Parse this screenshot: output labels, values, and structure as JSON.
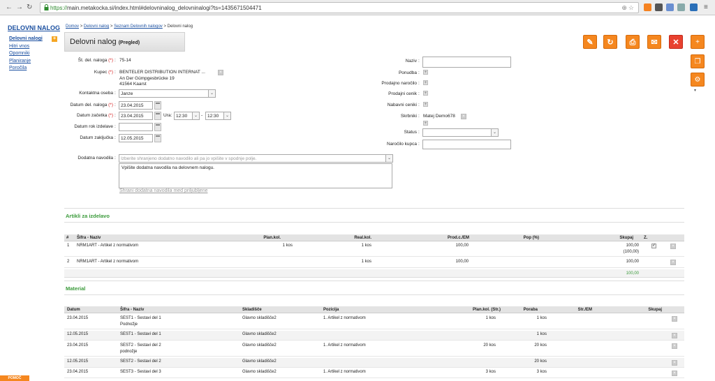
{
  "browser": {
    "url_scheme": "https://",
    "url_rest": "main.metakocka.si/index.html#delovninalog_delovninalogi?ts=1435671504471"
  },
  "sidebar": {
    "title": "DELOVNI NALOG",
    "items": [
      {
        "label": "Delovni nalogi"
      },
      {
        "label": "Hitri vnos"
      },
      {
        "label": "Opomniki"
      },
      {
        "label": "Planiranje"
      },
      {
        "label": "Poročila"
      }
    ],
    "help_label": "POMOČ"
  },
  "breadcrumb": {
    "home": "Domov",
    "sep": ">",
    "l1": "Delovni nalog",
    "l2": "Seznam Delovnih nalogov",
    "current": "Delovni nalog"
  },
  "page": {
    "title": "Delovni nalog",
    "mode": "(Pregled)"
  },
  "toolbar": {
    "edit_icon": "✎",
    "refresh_icon": "↻",
    "print_icon": "⎙",
    "mail_icon": "✉",
    "delete_icon": "✕",
    "add_icon": "+",
    "copy_icon": "❐",
    "settings_icon": "⚙",
    "more_icon": "▾"
  },
  "form_left": {
    "st_label": "Št. del. naloga",
    "st_value": "75-14",
    "kupec_label": "Kupec",
    "kupec_line1": "BENTELER DISTRIBUTION INTERNAT ...",
    "kupec_line2": "An Der Gümpgesbrücke 19",
    "kupec_line3": "41564 Kaarst",
    "kontakt_label": "Kontaktna oseba",
    "kontakt_value": "Janze",
    "datum_del_label": "Datum del. naloga",
    "datum_del_value": "23.04.2015",
    "datum_zac_label": "Datum začetka",
    "datum_zac_value": "23.04.2015",
    "ura_label": "Ura:",
    "ura_from": "12:30",
    "ura_to": "12:30",
    "ura_dash": "-",
    "rok_label": "Datum rok izdelave",
    "rok_value": "",
    "zakljucka_label": "Datum zaključka",
    "zakljucka_value": "12.05.2015",
    "req_mark": "(*)",
    "colon": ":"
  },
  "form_right": {
    "naziv_label": "Naziv",
    "ponudba_label": "Ponudba",
    "prodajno_narocilo_label": "Prodajno naročilo",
    "prodajni_cenik_label": "Prodajni cenik",
    "nabavni_ceniki_label": "Nabavni ceniki",
    "skrbniki_label": "Skrbniki",
    "skrbniki_value": "Matej Demo678",
    "status_label": "Status",
    "narocilo_kupca_label": "Naročilo kupca"
  },
  "dodatna": {
    "label": "Dodatna navodila",
    "select_placeholder": "Izberite shranjeno dodatno navodilo ali pa jo vpišite v spodnje polje.",
    "text": "Vpišite dodatna navodila na delovnem nalogu.",
    "save_link": "Shrani dodatna navodila med priljubljene"
  },
  "artikli": {
    "title": "Artikli za izdelavo",
    "headers": [
      "#",
      "Šifra - Naziv",
      "Plan.kol.",
      "Real.kol.",
      "Prod.c./EM",
      "Pop (%)",
      "Skupaj",
      "Z."
    ],
    "rows": [
      {
        "n": "1",
        "name": "NRM1ART - Artikel z normativom",
        "plan": "1 kos",
        "real": "1 kos",
        "prod": "100,00",
        "pop": "",
        "skupaj": "100,00",
        "skupaj2": "(100,00)",
        "z": "✓"
      },
      {
        "n": "2",
        "name": "NRM1ART - Artikel z normativom",
        "plan": "",
        "real": "1 kos",
        "prod": "100,00",
        "pop": "",
        "skupaj": "100,00",
        "skupaj2": "",
        "z": ""
      }
    ],
    "total": "100,00"
  },
  "material": {
    "title": "Material",
    "headers": [
      "Datum",
      "Šifra - Naziv",
      "Skladišče",
      "Pozicija",
      "Plan.kol. (Str.)",
      "Poraba",
      "Str./EM",
      "Skupaj"
    ],
    "rows": [
      {
        "datum": "23.04.2015",
        "name": "SEST1 - Sestavi del 1",
        "name2": "Podnožje",
        "sklad": "Glavno skladišče2",
        "poz": "1. Artikel z normativom",
        "plan": "1 kos",
        "poraba": "1 kos",
        "str": "",
        "skupaj": ""
      },
      {
        "datum": "12.05.2015",
        "name": "SEST1 - Sestavi del 1",
        "name2": "",
        "sklad": "Glavno skladišče2",
        "poz": "",
        "plan": "",
        "poraba": "1 kos",
        "str": "",
        "skupaj": ""
      },
      {
        "datum": "23.04.2015",
        "name": "SEST2 - Sestavi del 2",
        "name2": "podnožje",
        "sklad": "Glavno skladišče2",
        "poz": "1. Artikel z normativom",
        "plan": "20 kos",
        "poraba": "20 kos",
        "str": "",
        "skupaj": ""
      },
      {
        "datum": "12.05.2015",
        "name": "SEST2 - Sestavi del 2",
        "name2": "",
        "sklad": "Glavno skladišče2",
        "poz": "",
        "plan": "",
        "poraba": "20 kos",
        "str": "",
        "skupaj": ""
      },
      {
        "datum": "23.04.2015",
        "name": "SEST3 - Sestavi del 3",
        "name2": "",
        "sklad": "Glavno skladišče2",
        "poz": "1. Artikel z normativom",
        "plan": "3 kos",
        "poraba": "3 kos",
        "str": "",
        "skupaj": ""
      }
    ]
  }
}
